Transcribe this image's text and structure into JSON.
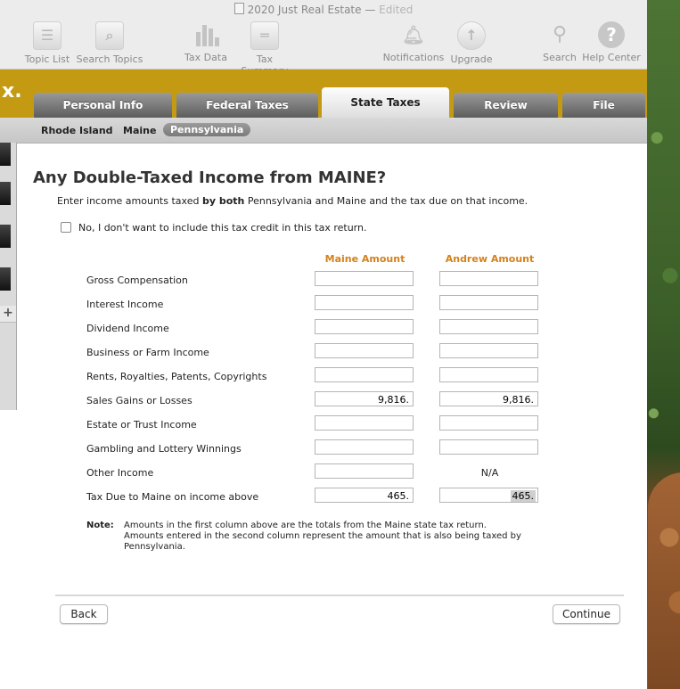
{
  "window": {
    "title": "2020 Just Real Estate",
    "status": "Edited"
  },
  "toolbar": {
    "items": [
      {
        "label": "Topic List",
        "icon": "list-icon"
      },
      {
        "label": "Search Topics",
        "icon": "search-topics-icon"
      },
      {
        "label": "Tax Data",
        "icon": "bar-chart-icon"
      },
      {
        "label": "Tax Summary",
        "icon": "summary-icon"
      },
      {
        "label": "Notifications",
        "icon": "bell-icon"
      },
      {
        "label": "Upgrade",
        "icon": "upgrade-icon"
      },
      {
        "label": "Search",
        "icon": "magnifier-icon"
      },
      {
        "label": "Help Center",
        "icon": "help-icon"
      }
    ]
  },
  "logo": "x.",
  "tabs": [
    "Personal Info",
    "Federal Taxes",
    "State Taxes",
    "Review",
    "File"
  ],
  "active_tab": "State Taxes",
  "subtabs": [
    "Rhode Island",
    "Maine",
    "Pennsylvania"
  ],
  "active_subtab": "Pennsylvania",
  "heading": "Any Double-Taxed Income from MAINE?",
  "instructions": {
    "pre": "Enter income amounts taxed ",
    "bold": "by both",
    "post": " Pennsylvania and Maine and the tax due on that income."
  },
  "optout_label": "No, I don't want to include this tax credit in this tax return.",
  "columns": [
    "Maine Amount",
    "Andrew Amount"
  ],
  "rows": [
    {
      "label": "Gross Compensation",
      "maine": "",
      "andrew": ""
    },
    {
      "label": "Interest Income",
      "maine": "",
      "andrew": ""
    },
    {
      "label": "Dividend Income",
      "maine": "",
      "andrew": ""
    },
    {
      "label": "Business or Farm Income",
      "maine": "",
      "andrew": ""
    },
    {
      "label": "Rents, Royalties, Patents, Copyrights",
      "maine": "",
      "andrew": ""
    },
    {
      "label": "Sales Gains or Losses",
      "maine": "9,816.",
      "andrew": "9,816."
    },
    {
      "label": "Estate or Trust Income",
      "maine": "",
      "andrew": ""
    },
    {
      "label": "Gambling and Lottery Winnings",
      "maine": "",
      "andrew": ""
    },
    {
      "label": "Other Income",
      "maine": "",
      "andrew": "N/A"
    },
    {
      "label": "Tax Due to Maine on income above",
      "maine": "465.",
      "andrew": "465."
    }
  ],
  "note": {
    "label": "Note:",
    "text": "Amounts in the first column above are the totals from the Maine state tax return. Amounts entered in the second column represent the amount that is also being taxed by Pennsylvania."
  },
  "buttons": {
    "back": "Back",
    "continue": "Continue"
  }
}
